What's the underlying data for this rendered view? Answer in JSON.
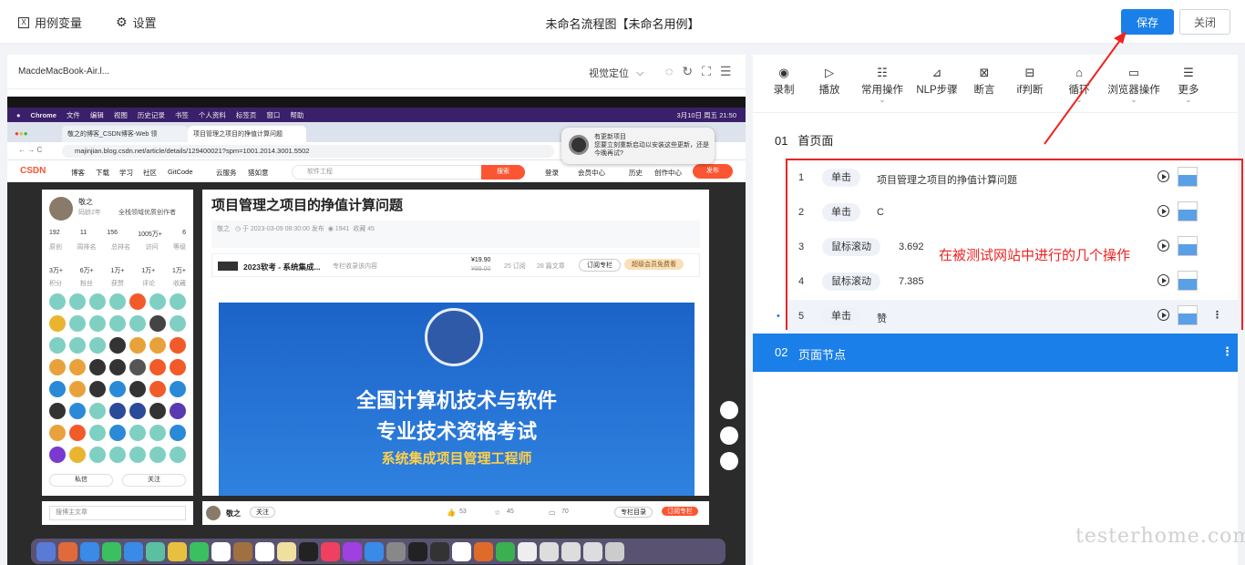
{
  "topbar": {
    "use_case_vars": "用例变量",
    "settings": "设置",
    "title": "未命名流程图【未命名用例】",
    "save": "保存",
    "close": "关闭"
  },
  "device": {
    "name": "MacdeMacBook-Air.l...",
    "locate": "视觉定位"
  },
  "mac": {
    "menu": [
      "Chrome",
      "文件",
      "编辑",
      "视图",
      "历史记录",
      "书签",
      "个人资料",
      "标签页",
      "窗口",
      "帮助"
    ],
    "clock": "3月10日 周五 21:50",
    "tab1": "敬之的博客_CSDN博客-Web 领",
    "tab2": "项目管理之项目的挣值计算问题",
    "url": "majinjian.blog.csdn.net/article/details/129400021?spm=1001.2014.3001.5502",
    "notify_title": "有更新项目",
    "notify_body": "您要立刻重新启动以安装这些更新，还是今晚再试?"
  },
  "csdn": {
    "logo": "CSDN",
    "nav": [
      "博客",
      "下载",
      "学习",
      "社区",
      "GitCode",
      "云服务",
      "猎如意"
    ],
    "search_placeholder": "软件工程",
    "search_btn": "搜索",
    "login": "登录",
    "member": "会员中心",
    "history": "历史",
    "create": "创作中心",
    "publish": "发布",
    "author": "敬之",
    "author_sub": "码龄2年",
    "author_tag": "全栈领域优质创作者",
    "stats1": [
      "192",
      "11",
      "156",
      "1005万+",
      "6"
    ],
    "stats1_labels": [
      "原创",
      "周排名",
      "总排名",
      "访问",
      "等级"
    ],
    "stats2": [
      "3万+",
      "6万+",
      "1万+",
      "1万+",
      "1万+"
    ],
    "stats2_labels": [
      "积分",
      "粉丝",
      "获赞",
      "评论",
      "收藏"
    ],
    "msg_btn": "私信",
    "follow_btn": "关注",
    "search_article": "搜博主文章",
    "article_title": "项目管理之项目的挣值计算问题",
    "meta_author": "敬之",
    "meta_date": "于 2023-03-09 08:30:00 发布",
    "meta_views": "1941",
    "meta_fav": "收藏 45",
    "column_title": "2023软考 - 系统集成...",
    "column_desc": "专栏收录该内容",
    "column_price": "¥19.90",
    "column_old": "¥99.00",
    "column_sub": "25 订阅",
    "column_count": "28 篇文章",
    "column_btn": "订阅专栏",
    "column_vip": "超级会员免费看",
    "banner1": "全国计算机技术与软件",
    "banner2": "专业技术资格考试",
    "banner3": "系统集成项目管理工程师",
    "bottom_author": "敬之",
    "bottom_follow": "关注",
    "likes": "53",
    "favs": "45",
    "comments": "70",
    "col_dir": "专栏目录",
    "col_sub": "订阅专栏"
  },
  "tools": [
    {
      "label": "录制",
      "icon": "record-icon",
      "chev": false
    },
    {
      "label": "播放",
      "icon": "play-icon",
      "chev": false
    },
    {
      "label": "常用操作",
      "icon": "list-icon",
      "chev": true
    },
    {
      "label": "NLP步骤",
      "icon": "nlp-icon",
      "chev": false
    },
    {
      "label": "断言",
      "icon": "assert-icon",
      "chev": false
    },
    {
      "label": "if判断",
      "icon": "if-icon",
      "chev": false
    },
    {
      "label": "循环",
      "icon": "loop-icon",
      "chev": true
    },
    {
      "label": "浏览器操作",
      "icon": "browser-icon",
      "chev": true
    },
    {
      "label": "更多",
      "icon": "menu-icon",
      "chev": true
    }
  ],
  "flow": {
    "node1_num": "01",
    "node1_title": "首页面",
    "node2_num": "02",
    "node2_title": "页面节点",
    "steps": [
      {
        "num": "1",
        "action": "单击",
        "value": "项目管理之项目的挣值计算问题"
      },
      {
        "num": "2",
        "action": "单击",
        "value": "C"
      },
      {
        "num": "3",
        "action": "鼠标滚动",
        "value": "3.692"
      },
      {
        "num": "4",
        "action": "鼠标滚动",
        "value": "7.385"
      },
      {
        "num": "5",
        "action": "单击",
        "value": "赞"
      }
    ]
  },
  "annotation": "在被测试网站中进行的几个操作",
  "watermark": "testerhome.com",
  "colors": {
    "primary": "#1a7fe8",
    "annotation": "#e22222"
  }
}
